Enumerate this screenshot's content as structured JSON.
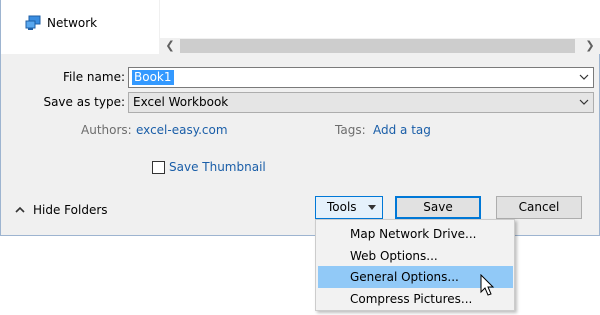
{
  "nav": {
    "network_label": "Network"
  },
  "form": {
    "filename_label": "File name:",
    "filename_value": "Book1",
    "savetype_label": "Save as type:",
    "savetype_value": "Excel Workbook",
    "authors_label": "Authors:",
    "authors_value": "excel-easy.com",
    "tags_label": "Tags:",
    "tags_value": "Add a tag",
    "thumbnail_label": "Save Thumbnail",
    "thumbnail_checked": false
  },
  "footer": {
    "hide_folders_label": "Hide Folders",
    "tools_label": "Tools",
    "save_label": "Save",
    "cancel_label": "Cancel"
  },
  "tools_menu": {
    "items": [
      {
        "label": "Map Network Drive..."
      },
      {
        "label": "Web Options..."
      },
      {
        "label": "General Options...",
        "highlighted": true
      },
      {
        "label": "Compress Pictures..."
      }
    ]
  },
  "colors": {
    "accent": "#0078d7",
    "link": "#1a5ea8",
    "selection": "#3399ff",
    "menu_highlight": "#91c9f7"
  }
}
